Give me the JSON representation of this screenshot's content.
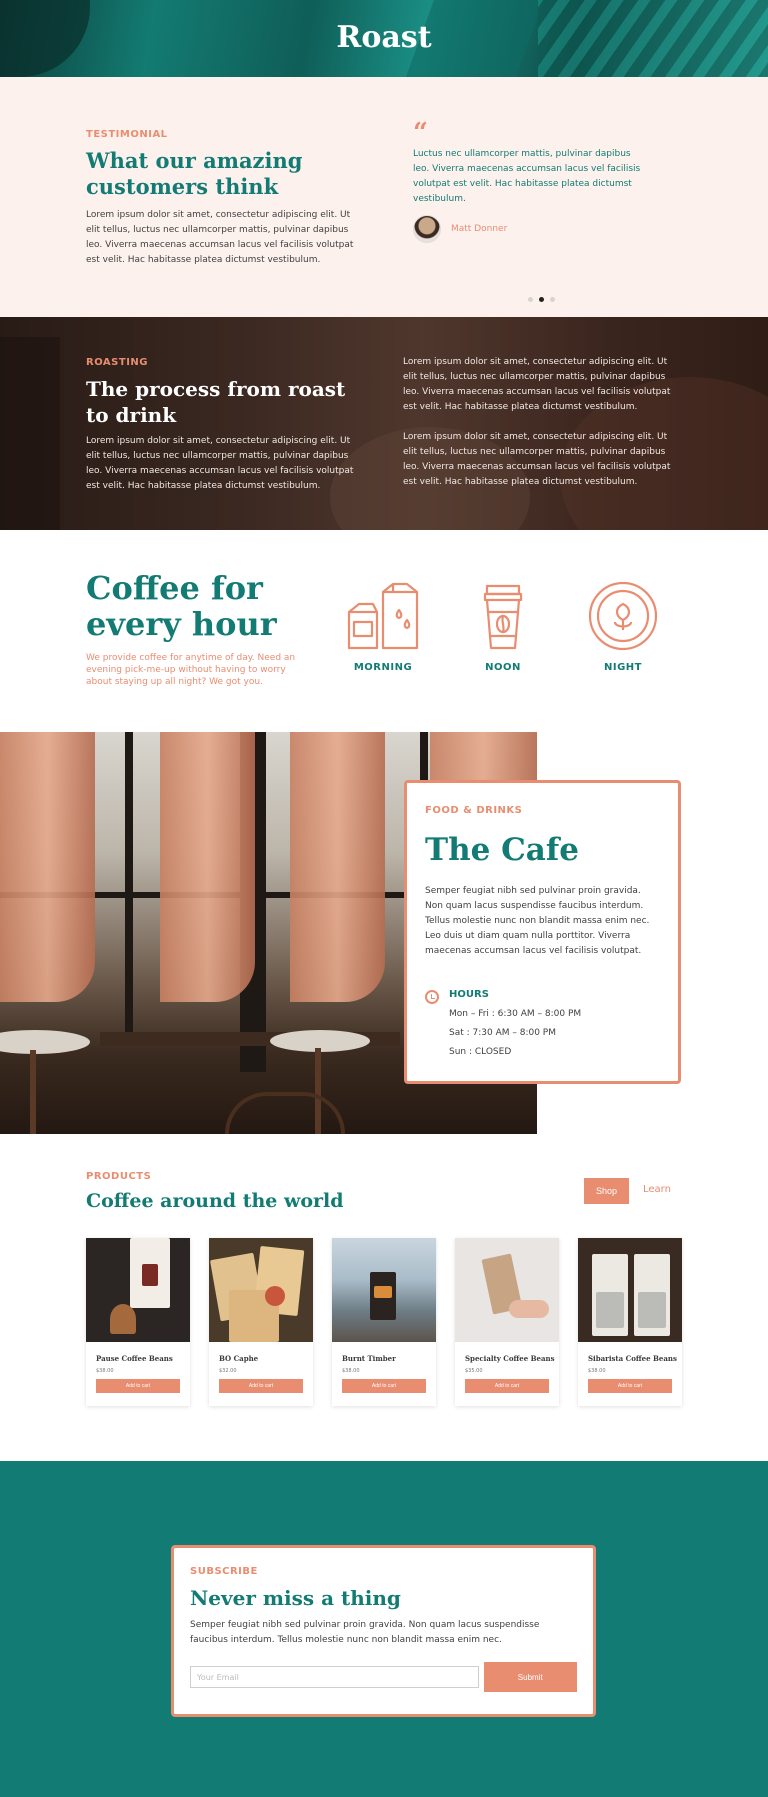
{
  "hero": {
    "title": "Roast"
  },
  "testimonial": {
    "eyebrow": "TESTIMONIAL",
    "heading": "What our amazing customers think",
    "body": "Lorem ipsum dolor sit amet, consectetur adipiscing elit. Ut elit tellus, luctus nec ullamcorper mattis, pulvinar dapibus leo. Viverra maecenas accumsan lacus vel facilisis volutpat est velit. Hac habitasse platea dictumst vestibulum.",
    "quote": "Luctus nec ullamcorper mattis, pulvinar dapibus leo. Viverra maecenas accumsan lacus vel facilisis volutpat est velit. Hac habitasse platea dictumst vestibulum.",
    "author": "Matt Donner",
    "slide_active": 2,
    "slide_count": 3
  },
  "roasting": {
    "eyebrow": "ROASTING",
    "heading": "The process from roast to drink",
    "body": "Lorem ipsum dolor sit amet, consectetur adipiscing elit. Ut elit tellus, luctus nec ullamcorper mattis, pulvinar dapibus leo. Viverra maecenas accumsan lacus vel facilisis volutpat est velit. Hac habitasse platea dictumst vestibulum.",
    "paragraph1": "Lorem ipsum dolor sit amet, consectetur adipiscing elit. Ut elit tellus, luctus nec ullamcorper mattis, pulvinar dapibus leo. Viverra maecenas accumsan lacus vel facilisis volutpat est velit. Hac habitasse platea dictumst vestibulum.",
    "paragraph2": "Lorem ipsum dolor sit amet, consectetur adipiscing elit. Ut elit tellus, luctus nec ullamcorper mattis, pulvinar dapibus leo. Viverra maecenas accumsan lacus vel facilisis volutpat est velit. Hac habitasse platea dictumst vestibulum."
  },
  "hours_section": {
    "heading": "Coffee for every hour",
    "body": "We provide coffee for anytime of day. Need an evening pick-me-up without having to worry about staying up all night? We got you.",
    "items": [
      {
        "label": "MORNING",
        "icon": "milk-cartons-icon"
      },
      {
        "label": "NOON",
        "icon": "coffee-cup-icon"
      },
      {
        "label": "NIGHT",
        "icon": "latte-art-icon"
      }
    ]
  },
  "cafe": {
    "eyebrow": "FOOD & DRINKS",
    "heading": "The Cafe",
    "body": "Semper feugiat nibh sed pulvinar proin gravida. Non quam lacus suspendisse faucibus interdum. Tellus molestie nunc non blandit massa enim nec. Leo duis ut diam quam nulla porttitor. Viverra maecenas accumsan lacus vel facilisis volutpat.",
    "hours_title": "HOURS",
    "hours": [
      "Mon – Fri : 6:30 AM – 8:00 PM",
      "Sat : 7:30 AM – 8:00 PM",
      "Sun : CLOSED"
    ]
  },
  "products": {
    "eyebrow": "PRODUCTS",
    "heading": "Coffee around the world",
    "shop_label": "Shop",
    "learn_label": "Learn",
    "add_label": "Add to cart",
    "items": [
      {
        "name": "Pause Coffee Beans",
        "price": "$38.00"
      },
      {
        "name": "BO Caphe",
        "price": "$32.00"
      },
      {
        "name": "Burnt Timber",
        "price": "$38.00"
      },
      {
        "name": "Specialty Coffee Beans",
        "price": "$35.00"
      },
      {
        "name": "Sibarista Coffee Beans",
        "price": "$38.00"
      }
    ]
  },
  "subscribe": {
    "eyebrow": "SUBSCRIBE",
    "heading": "Never miss a thing",
    "body": "Semper feugiat nibh sed pulvinar proin gravida. Non quam lacus suspendisse faucibus interdum. Tellus molestie nunc non blandit massa enim nec.",
    "email_placeholder": "Your Email",
    "submit_label": "Submit"
  },
  "colors": {
    "teal": "#127b73",
    "salmon": "#e98d71",
    "blush": "#fdf1ee"
  }
}
